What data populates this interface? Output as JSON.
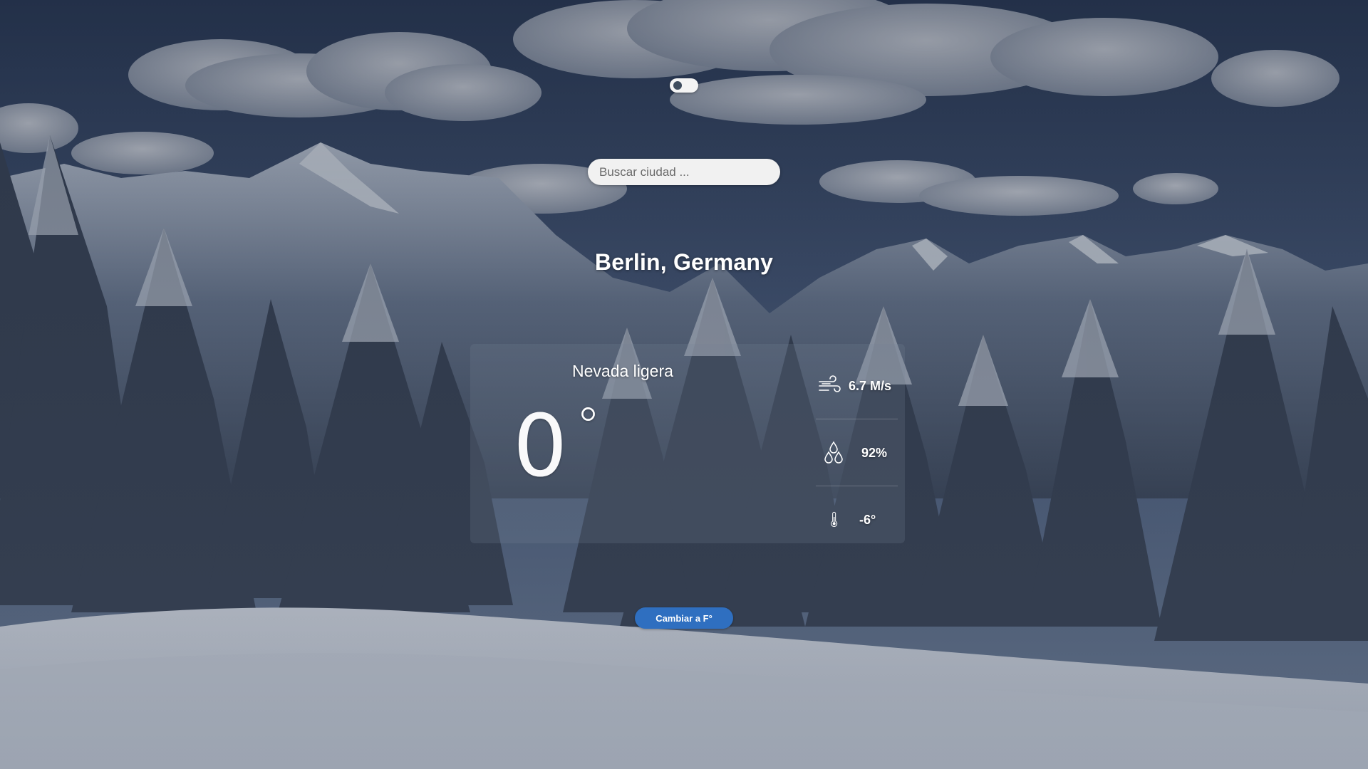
{
  "theme_toggle": {
    "state": "dark"
  },
  "search": {
    "placeholder": "Buscar ciudad ...",
    "value": ""
  },
  "location": {
    "city": "Berlin, Germany"
  },
  "weather": {
    "description": "Nevada ligera",
    "temperature": "0",
    "temperature_unit": "°",
    "wind": "6.7 M/s",
    "humidity": "92%",
    "feels_like": "-6°"
  },
  "icons": {
    "wind": "wind-icon",
    "humidity": "humidity-drops-icon",
    "feels_like": "thermometer-icon"
  },
  "unit_button": {
    "label": "Cambiar a F°"
  },
  "colors": {
    "accent": "#2f6fc0",
    "text": "#ffffff",
    "search_bg": "#f1f1f1"
  }
}
